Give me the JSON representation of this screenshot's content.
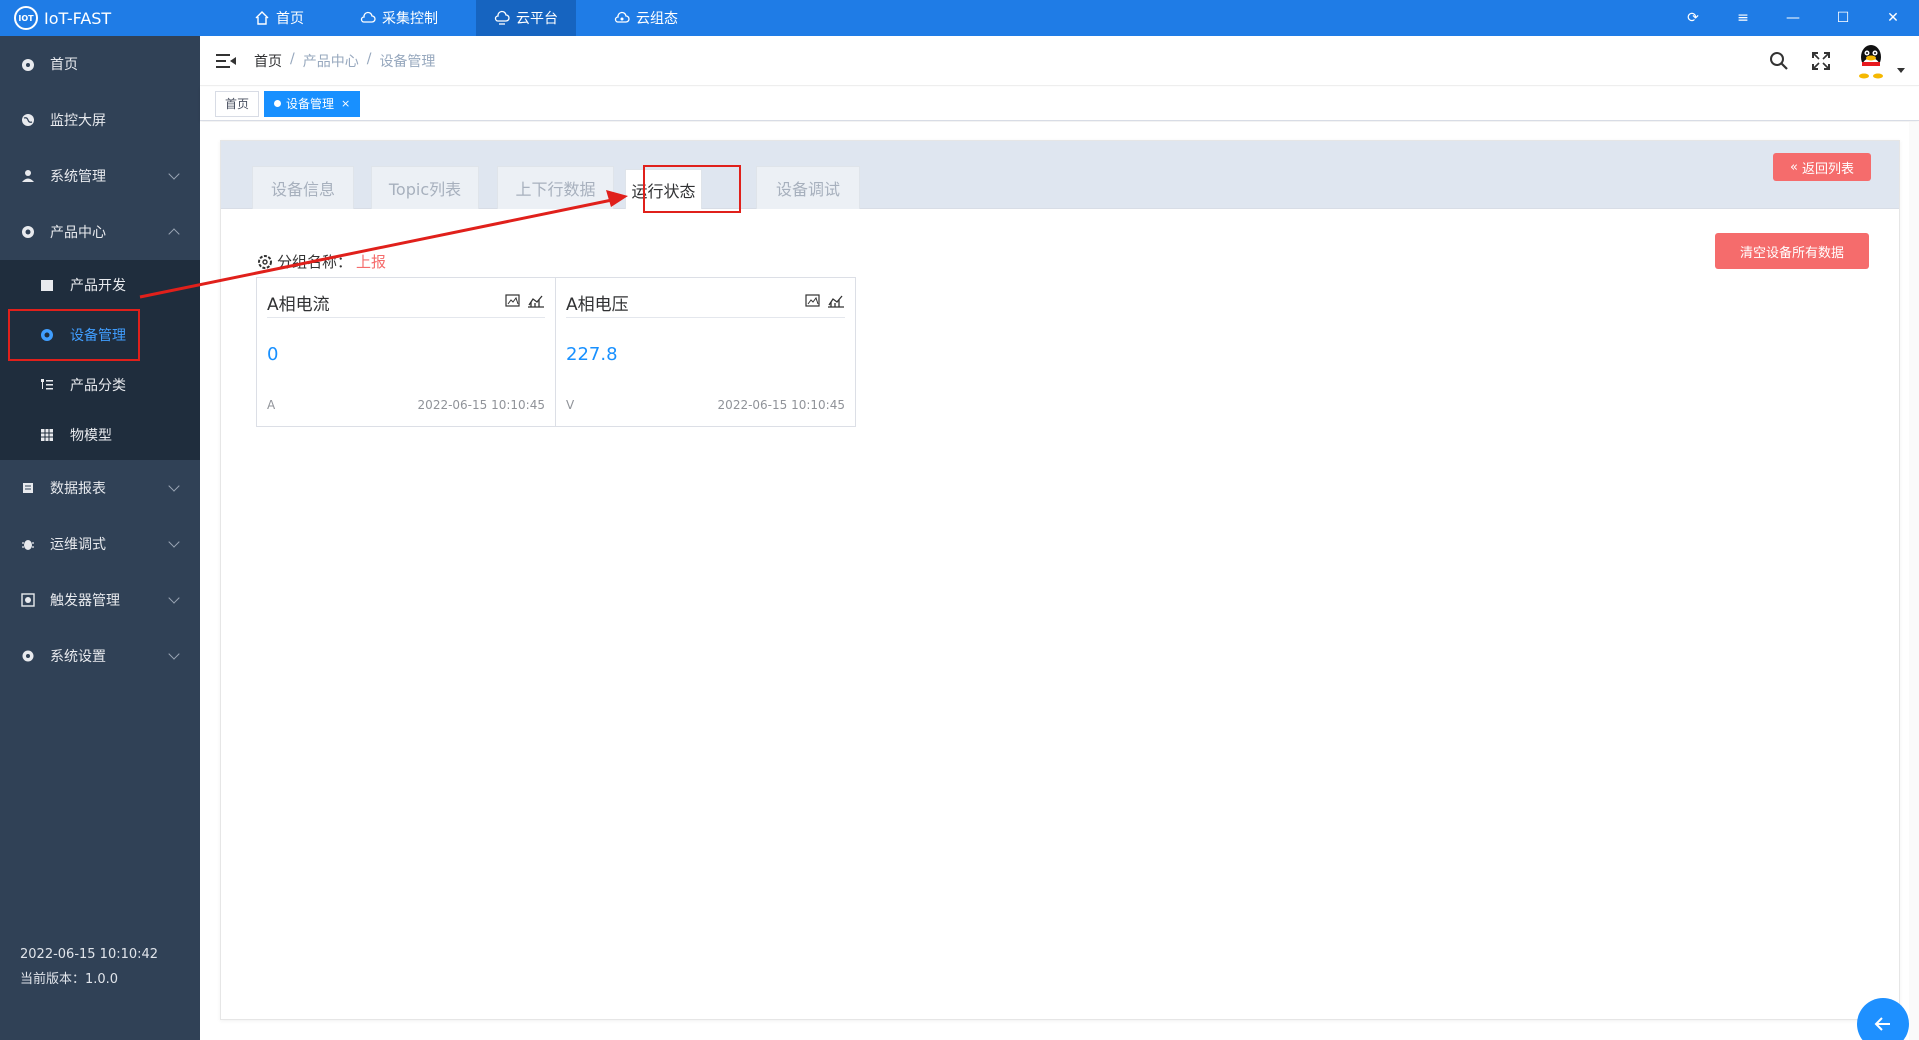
{
  "app": {
    "title": "IoT-FAST",
    "logo_text": "IOT"
  },
  "top_nav": [
    {
      "label": "首页",
      "icon": "home-icon"
    },
    {
      "label": "采集控制",
      "icon": "cloud-icon"
    },
    {
      "label": "云平台",
      "icon": "cloud-platform-icon"
    },
    {
      "label": "云组态",
      "icon": "cloud-config-icon"
    }
  ],
  "window_controls": {
    "refresh": "⟳",
    "menu": "≡",
    "minimize": "—",
    "maximize": "☐",
    "close": "✕"
  },
  "sidebar": {
    "items": [
      {
        "label": "首页"
      },
      {
        "label": "监控大屏"
      },
      {
        "label": "系统管理"
      },
      {
        "label": "产品中心"
      },
      {
        "label": "数据报表"
      },
      {
        "label": "运维调式"
      },
      {
        "label": "触发器管理"
      },
      {
        "label": "系统设置"
      }
    ],
    "submenu": [
      {
        "label": "产品开发"
      },
      {
        "label": "设备管理"
      },
      {
        "label": "产品分类"
      },
      {
        "label": "物模型"
      }
    ],
    "footer_time": "2022-06-15 10:10:42",
    "footer_version": "当前版本：1.0.0"
  },
  "breadcrumb": [
    "首页",
    "/",
    "产品中心",
    "/",
    "设备管理"
  ],
  "tags": [
    {
      "label": "首页"
    },
    {
      "label": "设备管理",
      "close": "×"
    }
  ],
  "tabs": [
    "设备信息",
    "Topic列表",
    "上下行数据",
    "运行状态",
    "设备调试"
  ],
  "buttons": {
    "back": "返回列表",
    "back_icon": "«",
    "clear": "清空设备所有数据"
  },
  "group": {
    "label": "分组名称：",
    "value": "上报"
  },
  "metrics": [
    {
      "title": "A相电流",
      "value": "0",
      "unit": "A",
      "time": "2022-06-15 10:10:45"
    },
    {
      "title": "A相电压",
      "value": "227.8",
      "unit": "V",
      "time": "2022-06-15 10:10:45"
    }
  ],
  "colors": {
    "primary": "#1f7ce6",
    "sidebar": "#304156",
    "danger": "#f56c6c",
    "annotation": "#e0201b"
  }
}
